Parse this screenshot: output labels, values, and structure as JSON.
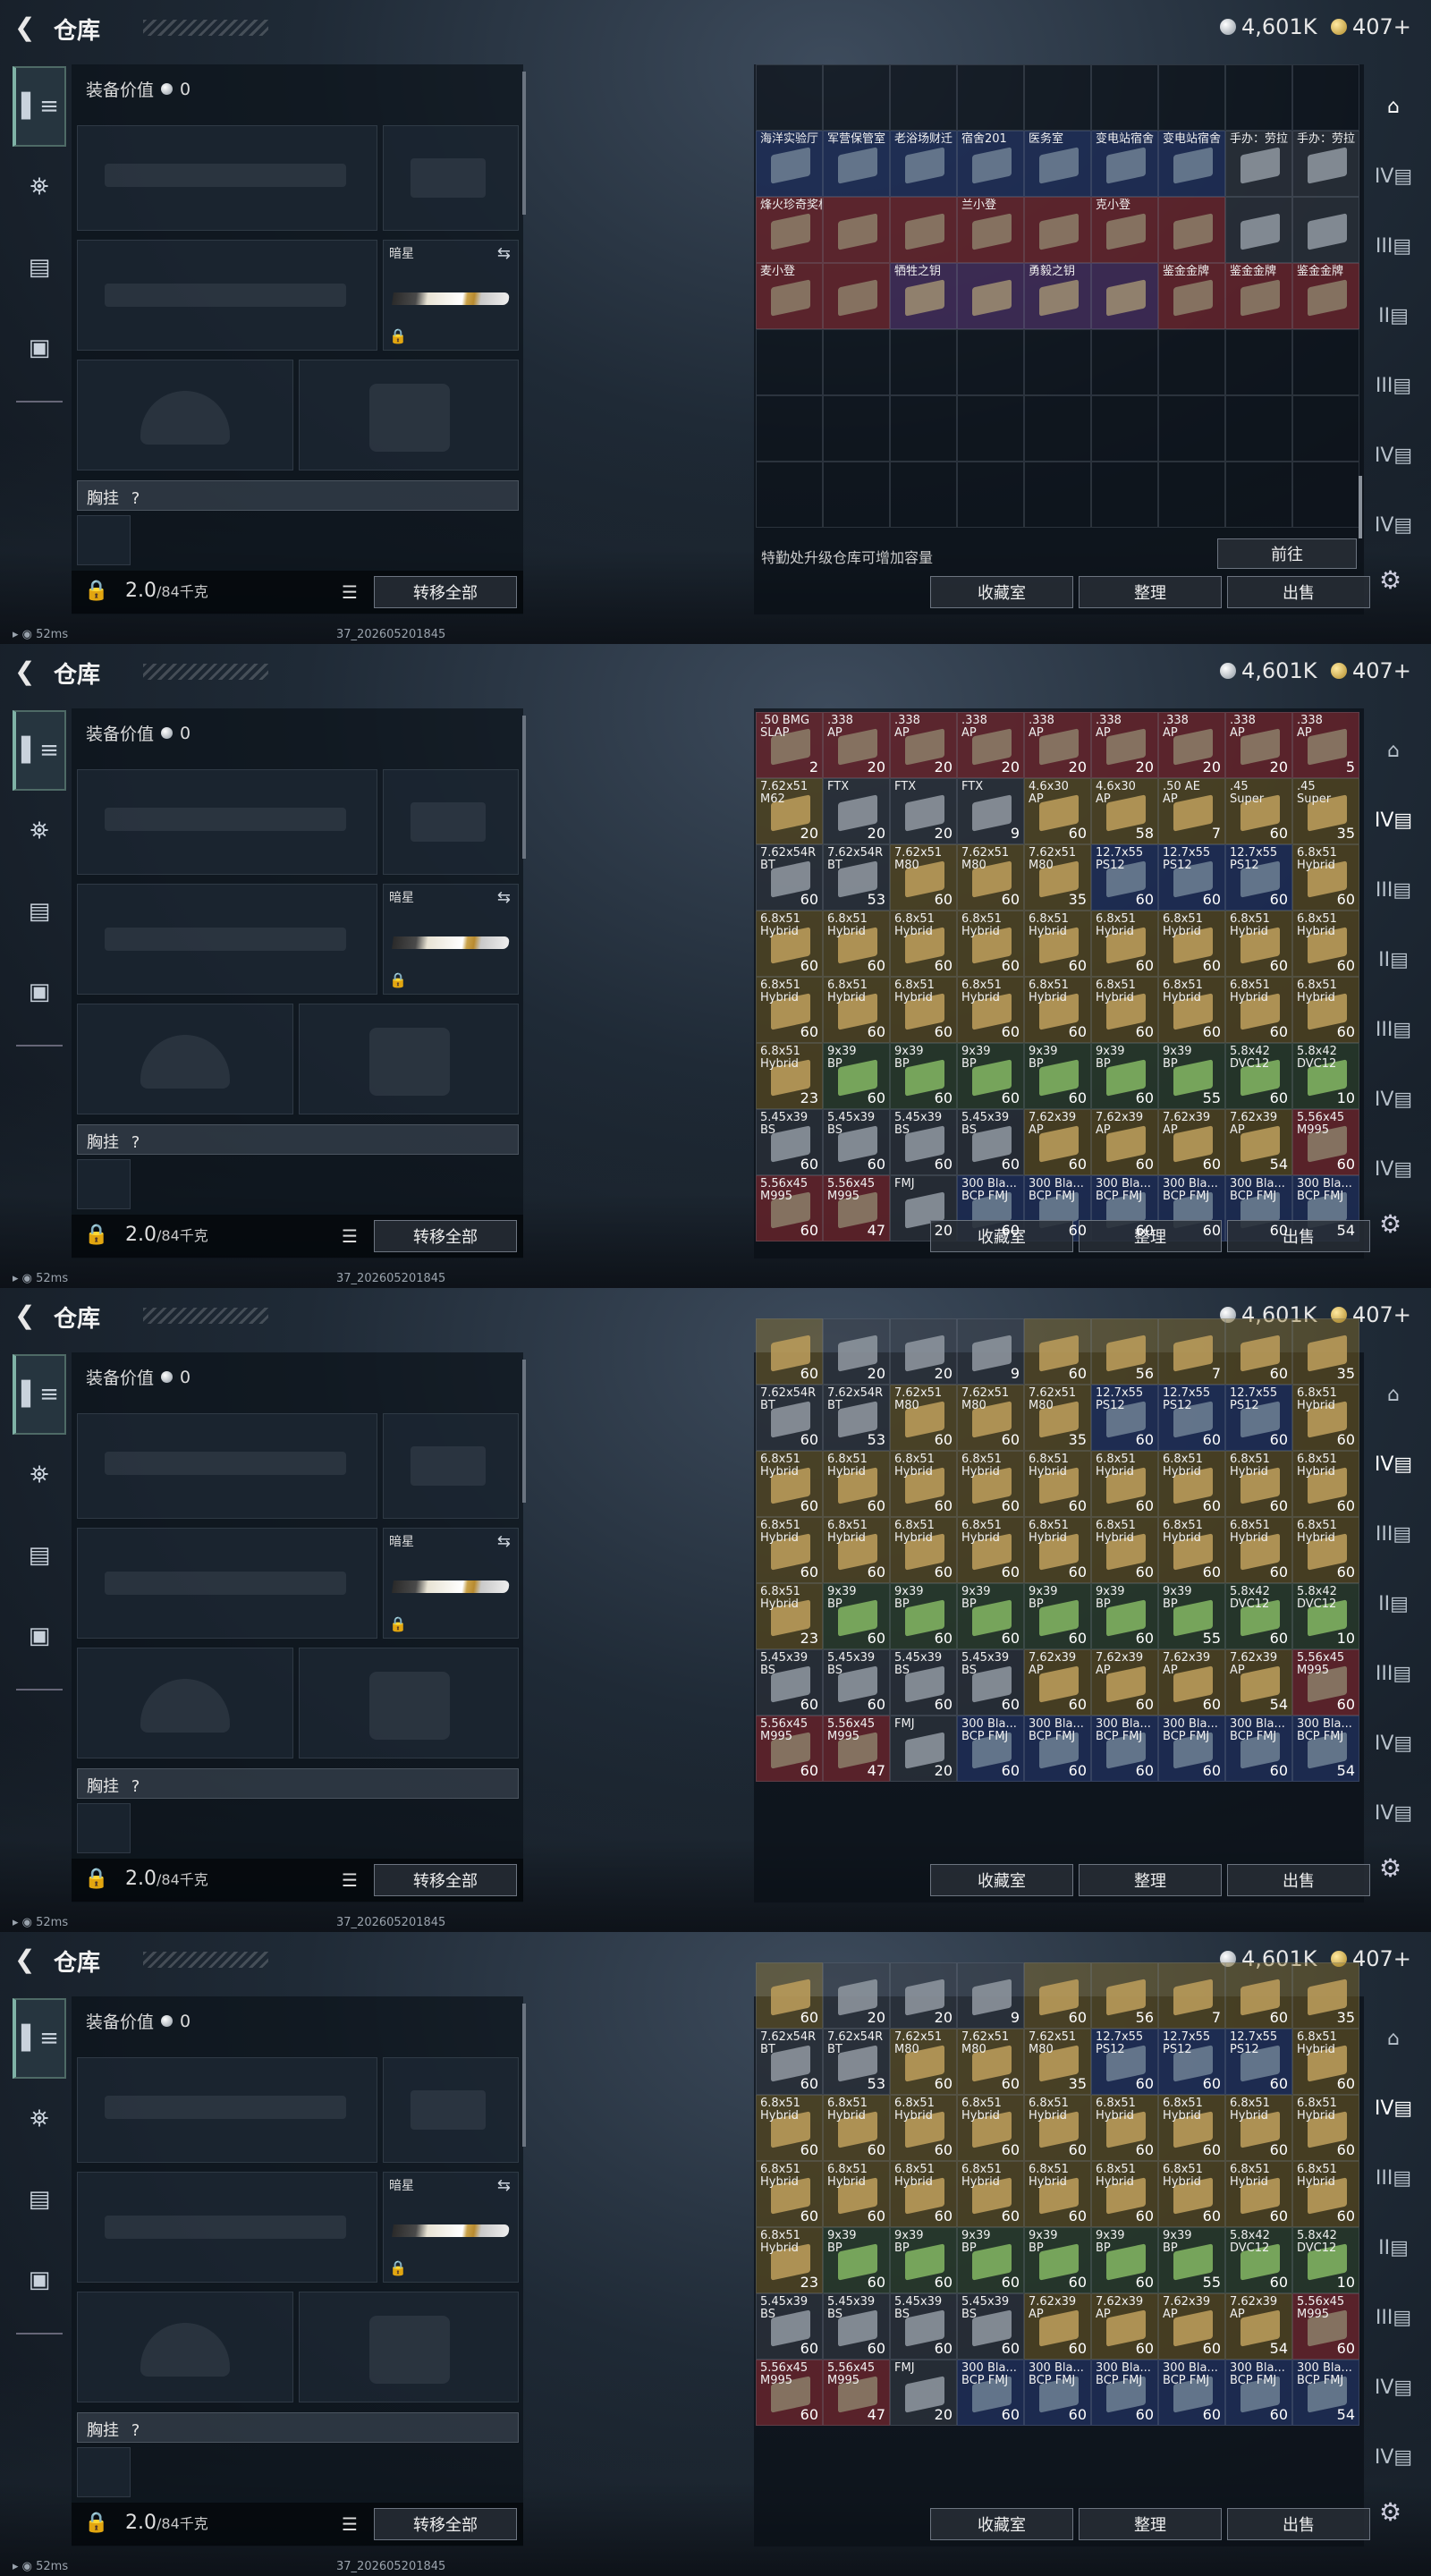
{
  "header": {
    "title": "仓库",
    "silver": "4,601K",
    "gold": "407+"
  },
  "equip": {
    "value_label": "装备价值",
    "value": "0",
    "sidearm_label": "暗星",
    "chest_label": "胸挂",
    "chest_q": "?",
    "weight": "2.0",
    "weight_max": "/84千克",
    "transfer_label": "转移全部"
  },
  "buttons": {
    "collection": "收藏室",
    "organize": "整理",
    "sell": "出售",
    "goto": "前往"
  },
  "inv_note": "特勤处升级仓库可增加容量",
  "status": {
    "ping": "52ms",
    "build": "37_202605201845"
  },
  "grid_a": [
    {
      "n": "海洋实验厅",
      "c": "",
      "k": "b"
    },
    {
      "n": "军营保管室",
      "c": "",
      "k": "b"
    },
    {
      "n": "老浴场财迁",
      "c": "",
      "k": "b"
    },
    {
      "n": "宿舍201",
      "c": "",
      "k": "b"
    },
    {
      "n": "医务室",
      "c": "",
      "k": "b"
    },
    {
      "n": "变电站宿舍",
      "c": "",
      "k": "b"
    },
    {
      "n": "变电站宿舍",
      "c": "",
      "k": "b"
    },
    {
      "n": "手办：劳拉",
      "c": "",
      "k": "n"
    },
    {
      "n": "手办：劳拉",
      "c": "",
      "k": "n"
    },
    {
      "n": "烽火珍奇奖杯",
      "c": "",
      "k": "r"
    },
    {
      "n": "",
      "c": "",
      "k": "r"
    },
    {
      "n": "",
      "c": "",
      "k": "r"
    },
    {
      "n": "兰小登",
      "c": "",
      "k": "r"
    },
    {
      "n": "",
      "c": "",
      "k": "r"
    },
    {
      "n": "克小登",
      "c": "",
      "k": "r"
    },
    {
      "n": "",
      "c": "",
      "k": "r"
    },
    {
      "n": "",
      "c": "",
      "k": "n"
    },
    {
      "n": "",
      "c": "",
      "k": "n"
    },
    {
      "n": "麦小登",
      "c": "",
      "k": "r"
    },
    {
      "n": "",
      "c": "",
      "k": "r"
    },
    {
      "n": "牺牲之钥",
      "c": "",
      "k": "p"
    },
    {
      "n": "",
      "c": "",
      "k": "p"
    },
    {
      "n": "勇毅之钥",
      "c": "",
      "k": "p"
    },
    {
      "n": "",
      "c": "",
      "k": "p"
    },
    {
      "n": "鉴金金牌",
      "c": "",
      "k": "r"
    },
    {
      "n": "鉴金金牌",
      "c": "",
      "k": "r"
    },
    {
      "n": "鉴金金牌",
      "c": "",
      "k": "r"
    }
  ],
  "grid_b": [
    {
      "n": ".50 BMG\nSLAP",
      "c": "2",
      "k": "r"
    },
    {
      "n": ".338\nAP",
      "c": "20",
      "k": "r"
    },
    {
      "n": ".338\nAP",
      "c": "20",
      "k": "r"
    },
    {
      "n": ".338\nAP",
      "c": "20",
      "k": "r"
    },
    {
      "n": ".338\nAP",
      "c": "20",
      "k": "r"
    },
    {
      "n": ".338\nAP",
      "c": "20",
      "k": "r"
    },
    {
      "n": ".338\nAP",
      "c": "20",
      "k": "r"
    },
    {
      "n": ".338\nAP",
      "c": "20",
      "k": "r"
    },
    {
      "n": ".338\nAP",
      "c": "5",
      "k": "r"
    },
    {
      "n": "7.62x51\nM62",
      "c": "20",
      "k": "y"
    },
    {
      "n": "FTX",
      "c": "20",
      "k": "n"
    },
    {
      "n": "FTX",
      "c": "20",
      "k": "n"
    },
    {
      "n": "FTX",
      "c": "9",
      "k": "n"
    },
    {
      "n": "4.6x30\nAP",
      "c": "60",
      "k": "y"
    },
    {
      "n": "4.6x30\nAP",
      "c": "58",
      "k": "y"
    },
    {
      "n": ".50 AE\nAP",
      "c": "7",
      "k": "y"
    },
    {
      "n": ".45\nSuper",
      "c": "60",
      "k": "y"
    },
    {
      "n": ".45\nSuper",
      "c": "35",
      "k": "y"
    }
  ],
  "grid_c": [
    {
      "n": "7.62x54R\nBT",
      "c": "60",
      "k": "n"
    },
    {
      "n": "7.62x54R\nBT",
      "c": "53",
      "k": "n"
    },
    {
      "n": "7.62x51\nM80",
      "c": "60",
      "k": "y"
    },
    {
      "n": "7.62x51\nM80",
      "c": "60",
      "k": "y"
    },
    {
      "n": "7.62x51\nM80",
      "c": "35",
      "k": "y"
    },
    {
      "n": "12.7x55\nPS12",
      "c": "60",
      "k": "b"
    },
    {
      "n": "12.7x55\nPS12",
      "c": "60",
      "k": "b"
    },
    {
      "n": "12.7x55\nPS12",
      "c": "60",
      "k": "b"
    },
    {
      "n": "6.8x51\nHybrid",
      "c": "60",
      "k": "y"
    },
    {
      "n": "6.8x51\nHybrid",
      "c": "60",
      "k": "y"
    },
    {
      "n": "6.8x51\nHybrid",
      "c": "60",
      "k": "y"
    },
    {
      "n": "6.8x51\nHybrid",
      "c": "60",
      "k": "y"
    },
    {
      "n": "6.8x51\nHybrid",
      "c": "60",
      "k": "y"
    },
    {
      "n": "6.8x51\nHybrid",
      "c": "60",
      "k": "y"
    },
    {
      "n": "6.8x51\nHybrid",
      "c": "60",
      "k": "y"
    },
    {
      "n": "6.8x51\nHybrid",
      "c": "60",
      "k": "y"
    },
    {
      "n": "6.8x51\nHybrid",
      "c": "60",
      "k": "y"
    },
    {
      "n": "6.8x51\nHybrid",
      "c": "60",
      "k": "y"
    },
    {
      "n": "6.8x51\nHybrid",
      "c": "60",
      "k": "y"
    },
    {
      "n": "6.8x51\nHybrid",
      "c": "60",
      "k": "y"
    },
    {
      "n": "6.8x51\nHybrid",
      "c": "60",
      "k": "y"
    },
    {
      "n": "6.8x51\nHybrid",
      "c": "60",
      "k": "y"
    },
    {
      "n": "6.8x51\nHybrid",
      "c": "60",
      "k": "y"
    },
    {
      "n": "6.8x51\nHybrid",
      "c": "60",
      "k": "y"
    },
    {
      "n": "6.8x51\nHybrid",
      "c": "60",
      "k": "y"
    },
    {
      "n": "6.8x51\nHybrid",
      "c": "60",
      "k": "y"
    },
    {
      "n": "6.8x51\nHybrid",
      "c": "60",
      "k": "y"
    },
    {
      "n": "6.8x51\nHybrid",
      "c": "23",
      "k": "y"
    },
    {
      "n": "9x39\nBP",
      "c": "60",
      "k": "g"
    },
    {
      "n": "9x39\nBP",
      "c": "60",
      "k": "g"
    },
    {
      "n": "9x39\nBP",
      "c": "60",
      "k": "g"
    },
    {
      "n": "9x39\nBP",
      "c": "60",
      "k": "g"
    },
    {
      "n": "9x39\nBP",
      "c": "60",
      "k": "g"
    },
    {
      "n": "9x39\nBP",
      "c": "55",
      "k": "g"
    },
    {
      "n": "5.8x42\nDVC12",
      "c": "60",
      "k": "g"
    },
    {
      "n": "5.8x42\nDVC12",
      "c": "10",
      "k": "g"
    },
    {
      "n": "5.45x39\nBS",
      "c": "60",
      "k": "n"
    },
    {
      "n": "5.45x39\nBS",
      "c": "60",
      "k": "n"
    },
    {
      "n": "5.45x39\nBS",
      "c": "60",
      "k": "n"
    },
    {
      "n": "5.45x39\nBS",
      "c": "60",
      "k": "n"
    },
    {
      "n": "7.62x39\nAP",
      "c": "60",
      "k": "y"
    },
    {
      "n": "7.62x39\nAP",
      "c": "60",
      "k": "y"
    },
    {
      "n": "7.62x39\nAP",
      "c": "60",
      "k": "y"
    },
    {
      "n": "7.62x39\nAP",
      "c": "54",
      "k": "y"
    },
    {
      "n": "5.56x45\nM995",
      "c": "60",
      "k": "r"
    },
    {
      "n": "5.56x45\nM995",
      "c": "60",
      "k": "r"
    },
    {
      "n": "5.56x45\nM995",
      "c": "47",
      "k": "r"
    },
    {
      "n": "FMJ",
      "c": "20",
      "k": "n"
    },
    {
      "n": "300 Bla...\nBCP FMJ",
      "c": "60",
      "k": "b"
    },
    {
      "n": "300 Bla...\nBCP FMJ",
      "c": "60",
      "k": "b"
    },
    {
      "n": "300 Bla...\nBCP FMJ",
      "c": "60",
      "k": "b"
    },
    {
      "n": "300 Bla...\nBCP FMJ",
      "c": "60",
      "k": "b"
    },
    {
      "n": "300 Bla...\nBCP FMJ",
      "c": "60",
      "k": "b"
    },
    {
      "n": "300 Bla...\nBCP FMJ",
      "c": "54",
      "k": "b"
    }
  ],
  "grid_top3": [
    {
      "n": "",
      "c": "60",
      "k": "y"
    },
    {
      "n": "",
      "c": "20",
      "k": "n"
    },
    {
      "n": "",
      "c": "20",
      "k": "n"
    },
    {
      "n": "",
      "c": "9",
      "k": "n"
    },
    {
      "n": "",
      "c": "60",
      "k": "y"
    },
    {
      "n": "",
      "c": "56",
      "k": "y"
    },
    {
      "n": "",
      "c": "7",
      "k": "y"
    },
    {
      "n": "",
      "c": "60",
      "k": "y"
    },
    {
      "n": "",
      "c": "35",
      "k": "y"
    }
  ]
}
